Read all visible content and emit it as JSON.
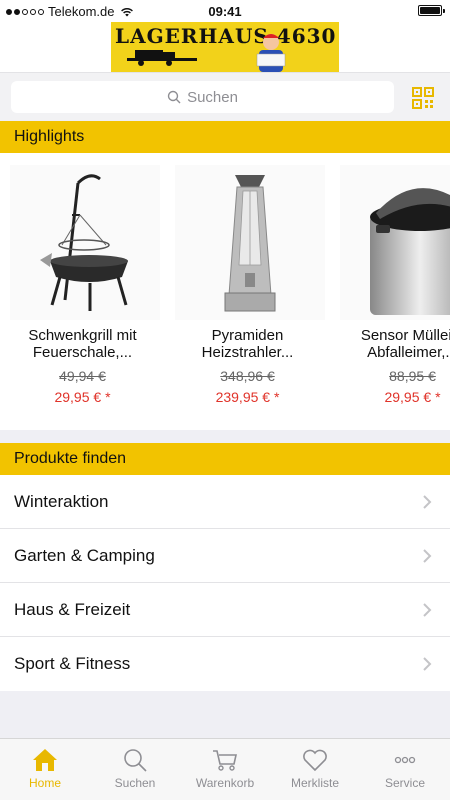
{
  "status_bar": {
    "carrier": "Telekom.de",
    "time": "09:41"
  },
  "logo": {
    "text": "LAGERHAUS 4630"
  },
  "search": {
    "placeholder": "Suchen",
    "icon": "search-icon",
    "qr_icon": "qr-code-icon"
  },
  "highlights": {
    "title": "Highlights",
    "products": [
      {
        "name_line1": "Schwenkgrill mit",
        "name_line2": "Feuerschale,...",
        "old_price": "49,94 €",
        "new_price": "29,95 € *"
      },
      {
        "name_line1": "Pyramiden",
        "name_line2": "Heizstrahler...",
        "old_price": "348,96 €",
        "new_price": "239,95 € *"
      },
      {
        "name_line1": "Sensor Mülleim",
        "name_line2": "Abfalleimer,...",
        "old_price": "88,95 €",
        "new_price": "29,95 € *"
      }
    ]
  },
  "categories": {
    "title": "Produkte finden",
    "items": [
      "Winteraktion",
      "Garten & Camping",
      "Haus & Freizeit",
      "Sport & Fitness"
    ]
  },
  "tabs": [
    {
      "label": "Home",
      "icon": "home-icon",
      "active": true
    },
    {
      "label": "Suchen",
      "icon": "search-icon",
      "active": false
    },
    {
      "label": "Warenkorb",
      "icon": "cart-icon",
      "active": false
    },
    {
      "label": "Merkliste",
      "icon": "heart-icon",
      "active": false
    },
    {
      "label": "Service",
      "icon": "more-icon",
      "active": false
    }
  ],
  "colors": {
    "accent": "#f2c300",
    "price_red": "#e0332a",
    "tab_active": "#e8b800"
  }
}
